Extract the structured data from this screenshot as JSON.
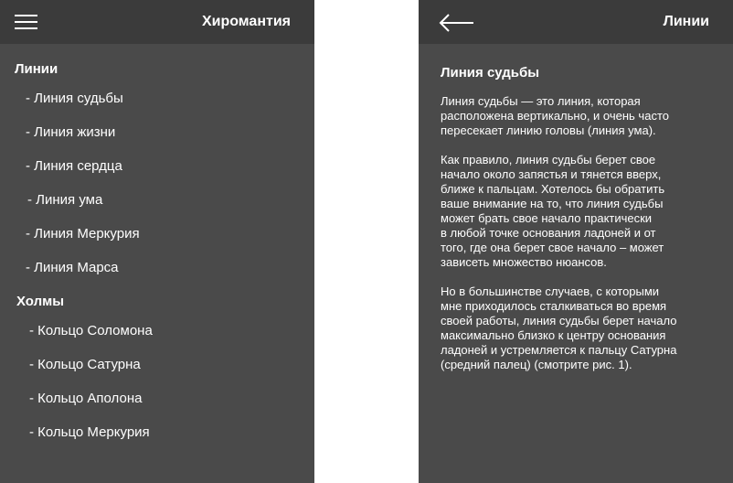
{
  "left_screen": {
    "app_title": "Хиромантия",
    "menu_icon": "hamburger-menu-icon",
    "sections": [
      {
        "header": "Линии",
        "items": [
          "- Линия судьбы",
          "- Линия жизни",
          "- Линия сердца",
          "- Линия ума",
          "- Линия Меркурия",
          "- Линия Марса"
        ]
      },
      {
        "header": "Холмы",
        "items": [
          "- Кольцо Соломона",
          "- Кольцо Сатурна",
          "- Кольцо Аполона",
          "- Кольцо Меркурия"
        ]
      }
    ]
  },
  "right_screen": {
    "app_title": "Линии",
    "back_icon": "back-arrow-icon",
    "article": {
      "title": "Линия судьбы",
      "paragraphs": [
        "Линия судьбы — это линия, которая\nрасположена вертикально, и очень часто\nпересекает линию головы (линия ума).",
        "Как правило, линия судьбы берет свое\nначало около запястья и тянется вверх,\nближе к пальцам. Хотелось бы обратить\nваше внимание на то, что линия судьбы\nможет брать свое начало практически\nв любой точке основания ладоней и от\nтого, где она берет свое начало – может\nзависеть множество нюансов.",
        "Но в большинстве случаев, с которыми\nмне приходилось сталкиваться во время\nсвоей работы, линия судьбы берет начало\n максимально близко к центру основания\n ладоней и устремляется к пальцу Сатурна\n(средний палец) (смотрите рис. 1)."
      ]
    }
  },
  "colors": {
    "appbar": "#3b3b3b",
    "background": "#4a4a4a",
    "text": "#ffffff",
    "gap": "#ffffff"
  }
}
